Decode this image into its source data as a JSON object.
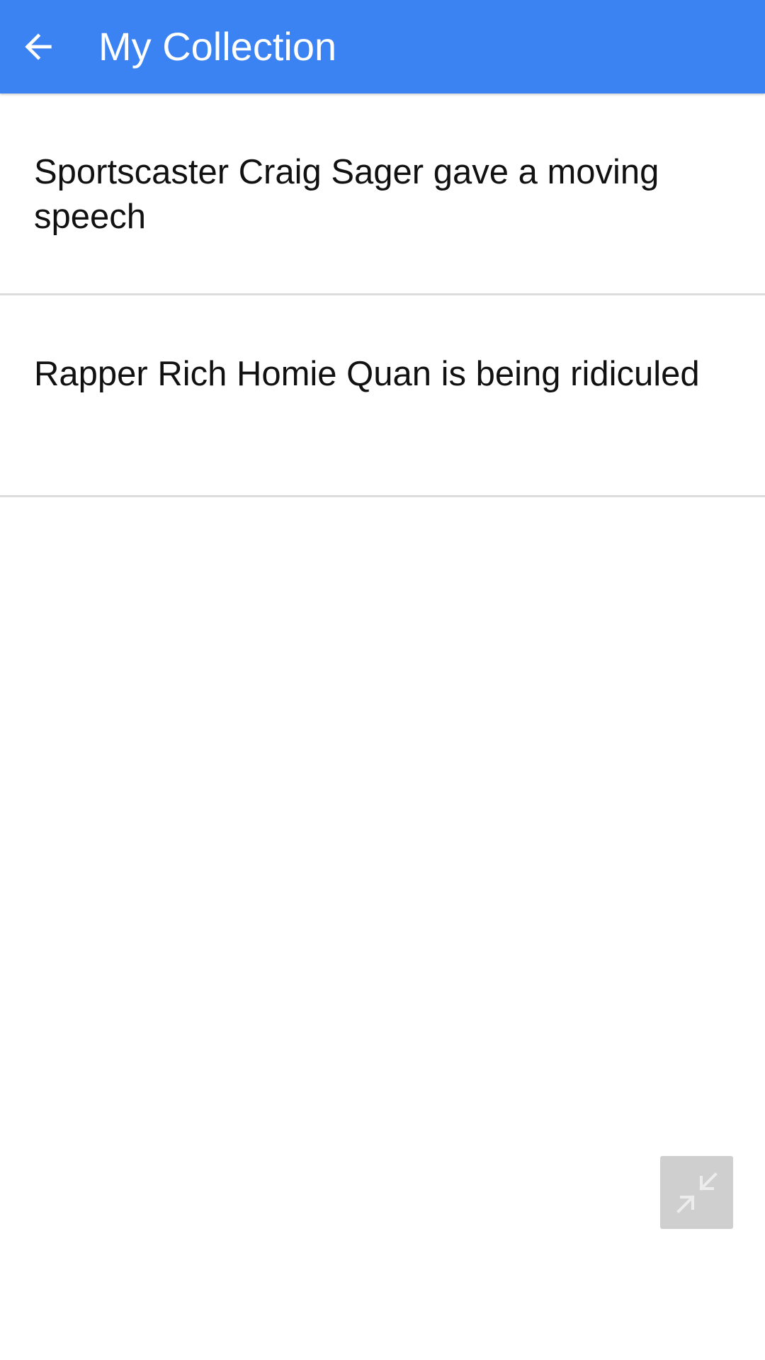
{
  "appbar": {
    "title": "My Collection",
    "back_icon": "arrow-back-icon",
    "color": "#3b82f3"
  },
  "collection": {
    "items": [
      {
        "title": "Sportscaster Craig Sager gave a moving speech"
      },
      {
        "title": "Rapper Rich Homie Quan is being ridiculed"
      }
    ]
  },
  "floating_button": {
    "icon": "collapse-arrows-icon",
    "color": "#cfcfcf"
  }
}
